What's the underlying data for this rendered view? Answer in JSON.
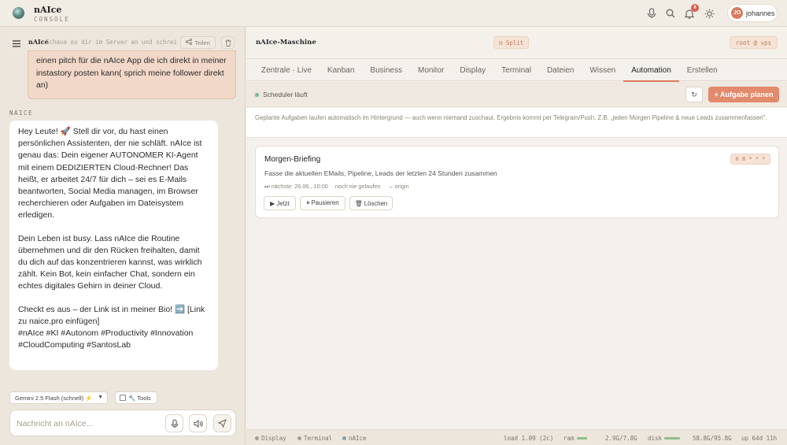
{
  "app": {
    "name": "nAIce",
    "subtitle": "CONSOLE",
    "notifications_count": "8",
    "user": {
      "initials": "JO",
      "name": "johannes"
    }
  },
  "chat": {
    "brand": "nAIce",
    "search_placeholder": "Schaue es dir im Server an und schrei…",
    "share_label": "Teilen",
    "user_message": "einen pitch für die nAIce App die ich direkt in meiner instastory posten kann( sprich meine follower direkt an)",
    "assistant_label": "NAICE",
    "assistant_paragraphs": [
      "Hey Leute! 🚀 Stell dir vor, du hast einen persönlichen Assistenten, der nie schläft. nAIce ist genau das: Dein eigener AUTONOMER KI-Agent mit einem DEDIZIERTEN Cloud-Rechner! Das heißt, er arbeitet 24/7 für dich – sei es E-Mails beantworten, Social Media managen, im Browser recherchieren oder Aufgaben im Dateisystem erledigen.",
      "Dein Leben ist busy. Lass nAIce die Routine übernehmen und dir den Rücken freihalten, damit du dich auf das konzentrieren kannst, was wirklich zählt. Kein Bot, kein einfacher Chat, sondern ein echtes digitales Gehirn in deiner Cloud.",
      "Checkt es aus – der Link ist in meiner Bio! ➡️ [Link zu naice.pro einfügen]\n#nAIce #KI #Autonom #Productivity #Innovation #CloudComputing #SantosLab"
    ],
    "model": "Gemini 2.5 Flash (schnell) ⚡",
    "tools_label": "🔧 Tools",
    "composer_placeholder": "Nachricht an nAIce..."
  },
  "machine": {
    "title": "nAIce-Maschine",
    "split_label": "⊡ Split",
    "root_label": "root @ vps",
    "tabs": [
      {
        "label": "Zentrale · Live",
        "active": false
      },
      {
        "label": "Kanban",
        "active": false
      },
      {
        "label": "Business",
        "active": false
      },
      {
        "label": "Monitor",
        "active": false
      },
      {
        "label": "Display",
        "active": false
      },
      {
        "label": "Terminal",
        "active": false
      },
      {
        "label": "Dateien",
        "active": false
      },
      {
        "label": "Wissen",
        "active": false
      },
      {
        "label": "Automation",
        "active": true
      },
      {
        "label": "Erstellen",
        "active": false
      }
    ],
    "scheduler_status": "Scheduler läuft",
    "refresh_icon": "↻",
    "plan_button": "+ Aufgabe planen",
    "info": "Geplante Aufgaben laufen automatisch im Hintergrund — auch wenn niemand zuschaut. Ergebnis kommt per Telegram/Push. Z.B. „jeden Morgen Pipeline & neue Leads zusammenfassen\".",
    "task": {
      "title": "Morgen-Briefing",
      "cron": "0 8 * * *",
      "description": "Fasse die aktuellen EMails, Pipeline, Leads der letzten 24 Stunden zusammen",
      "next_run": "⏭ nächste: 26.06., 10:00",
      "last_run": "noch nie gelaufen",
      "origin": "→ origin",
      "buttons": {
        "run": "▶ Jetzt",
        "pause": "⏸ Pausieren",
        "delete": "🗑 Löschen"
      }
    }
  },
  "statusbar": {
    "display": "Display",
    "terminal": "Terminal",
    "naice": "nAIce",
    "load": "load 1.09 (2c)",
    "ram_label": "ram",
    "ram_value": "2.9G/7.8G",
    "disk_label": "disk",
    "disk_value": "58.8G/95.8G",
    "uptime": "up 64d 11h"
  },
  "colors": {
    "accent": "#e28a6c",
    "user_bubble": "#f2d8c8",
    "status_green": "#7fb99b"
  },
  "icons": [
    "logo",
    "mic-icon",
    "search-icon",
    "bell-icon",
    "sun-icon",
    "menu-icon",
    "share-icon",
    "trash-icon",
    "speaker-icon",
    "send-icon",
    "refresh-icon"
  ]
}
